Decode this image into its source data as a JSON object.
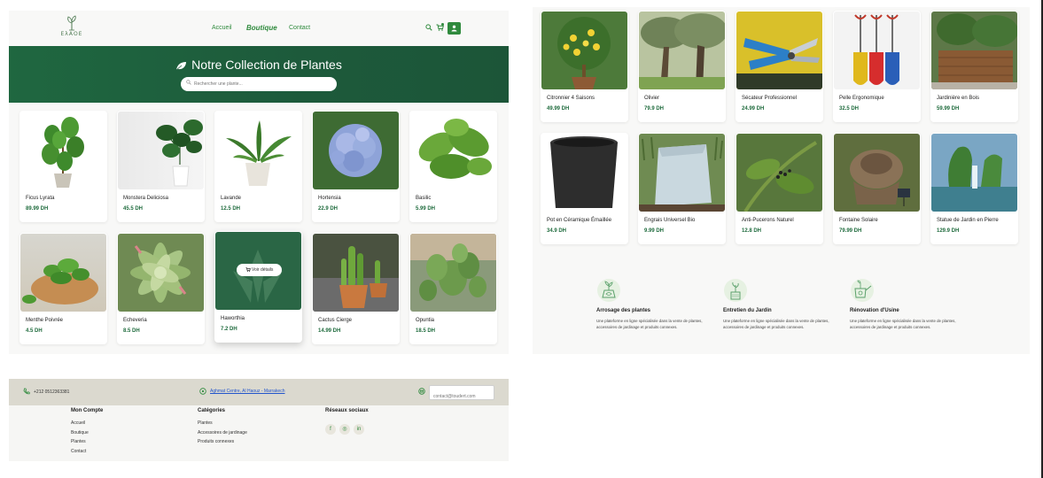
{
  "brand": {
    "logo_text": "ЕλАОЕ"
  },
  "nav": {
    "accueil": "Accueil",
    "boutique": "Boutique",
    "contact": "Contact"
  },
  "hero": {
    "title": "Notre Collection de Plantes",
    "search_placeholder": "Rechercher une plante..."
  },
  "hover_action": "Voir détails",
  "products_left": [
    {
      "name": "Ficus Lyrata",
      "price": "89.99 DH"
    },
    {
      "name": "Monstera Deliciosa",
      "price": "45.5 DH"
    },
    {
      "name": "Lavande",
      "price": "12.5 DH"
    },
    {
      "name": "Hortensia",
      "price": "22.9 DH"
    },
    {
      "name": "Basilic",
      "price": "5.99 DH"
    },
    {
      "name": "Menthe Poivrée",
      "price": "4.5 DH"
    },
    {
      "name": "Echeveria",
      "price": "8.5 DH"
    },
    {
      "name": "Haworthia",
      "price": "7.2 DH"
    },
    {
      "name": "Cactus Cierge",
      "price": "14.99 DH"
    },
    {
      "name": "Opuntia",
      "price": "18.5 DH"
    }
  ],
  "products_right": [
    {
      "name": "Citronnier 4 Saisons",
      "price": "49.99 DH"
    },
    {
      "name": "Olivier",
      "price": "79.9 DH"
    },
    {
      "name": "Sécateur Professionnel",
      "price": "24.99 DH"
    },
    {
      "name": "Pelle Ergonomique",
      "price": "32.5 DH"
    },
    {
      "name": "Jardinière en Bois",
      "price": "59.99 DH"
    },
    {
      "name": "Pot en Céramique Émaillée",
      "price": "34.9 DH"
    },
    {
      "name": "Engrais Universel Bio",
      "price": "9.99 DH"
    },
    {
      "name": "Anti-Pucerons Naturel",
      "price": "12.8 DH"
    },
    {
      "name": "Fontaine Solaire",
      "price": "79.99 DH"
    },
    {
      "name": "Statue de Jardin en Pierre",
      "price": "129.9 DH"
    }
  ],
  "features": [
    {
      "title": "Arrosage des plantes",
      "text": "Une plateforme en ligne spécialisée dans la vente de plantes, accessoires de jardinage et produits connexes."
    },
    {
      "title": "Entretien du Jardin",
      "text": "Une plateforme en ligne spécialisée dans la vente de plantes, accessoires de jardinage et produits connexes."
    },
    {
      "title": "Rénovation d'Usine",
      "text": "Une plateforme en ligne spécialisée dans la vente de plantes, accessoires de jardinage et produits connexes."
    }
  ],
  "footer": {
    "phone": "+212 0512363381",
    "address": "Aghmat Centre, Al Haouz - Marrakech",
    "email_placeholder": "contact@toudert.com",
    "account": {
      "title": "Mon Compte",
      "links": [
        "Accueil",
        "Boutique",
        "Plantes",
        "Contact"
      ]
    },
    "categories": {
      "title": "Catégories",
      "links": [
        "Plantes",
        "Accessoires de jardinage",
        "Produits connexes"
      ]
    },
    "social": {
      "title": "Réseaux sociaux",
      "icons": [
        "f",
        "◎",
        "in"
      ]
    }
  },
  "colors": {
    "brand_green": "#2f8a3d",
    "hero_green": "#1d5a3b",
    "price_green": "#1f6b3d"
  }
}
